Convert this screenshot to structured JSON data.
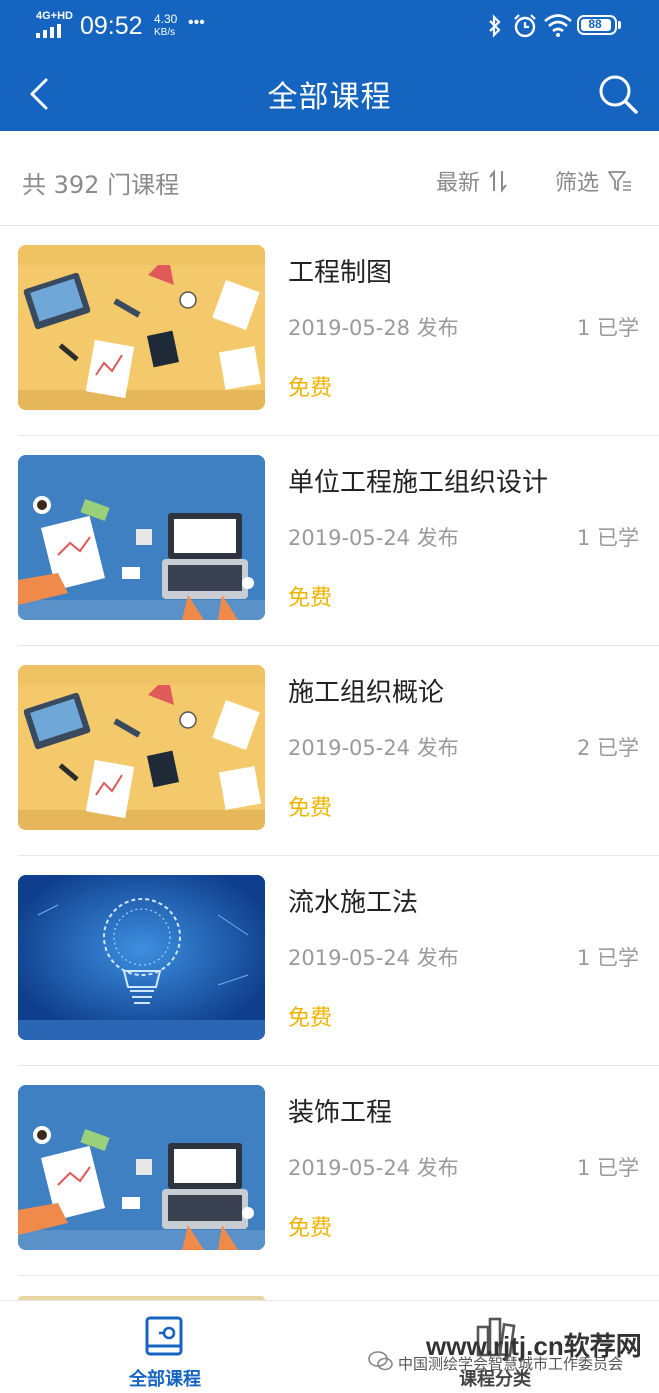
{
  "status": {
    "network": "4G+HD",
    "time": "09:52",
    "speed_value": "4.30",
    "speed_unit": "KB/s",
    "dots": "•••",
    "battery": "88"
  },
  "nav": {
    "title": "全部课程"
  },
  "filter": {
    "count_text": "共 392 门课程",
    "sort_label": "最新",
    "filter_label": "筛选"
  },
  "courses": [
    {
      "title": "工程制图",
      "date": "2019-05-28 发布",
      "learners": "1 已学",
      "price": "免费",
      "thumb": "desk-yellow"
    },
    {
      "title": "单位工程施工组织设计",
      "date": "2019-05-24 发布",
      "learners": "1 已学",
      "price": "免费",
      "thumb": "desk-blue"
    },
    {
      "title": "施工组织概论",
      "date": "2019-05-24 发布",
      "learners": "2 已学",
      "price": "免费",
      "thumb": "desk-yellow"
    },
    {
      "title": "流水施工法",
      "date": "2019-05-24 发布",
      "learners": "1 已学",
      "price": "免费",
      "thumb": "lightbulb-blue"
    },
    {
      "title": "装饰工程",
      "date": "2019-05-24 发布",
      "learners": "1 已学",
      "price": "免费",
      "thumb": "desk-blue"
    }
  ],
  "tabs": [
    {
      "label": "全部课程",
      "icon": "book-icon",
      "active": true
    },
    {
      "label": "课程分类",
      "icon": "category-icon",
      "active": false
    }
  ],
  "watermark": {
    "site": "www.rjtj.cn软荐网",
    "org": "中国测绘学会智慧城市工作委员会"
  },
  "colors": {
    "brand": "#1464c0",
    "price": "#f0b400",
    "muted": "#9a9a9a"
  }
}
